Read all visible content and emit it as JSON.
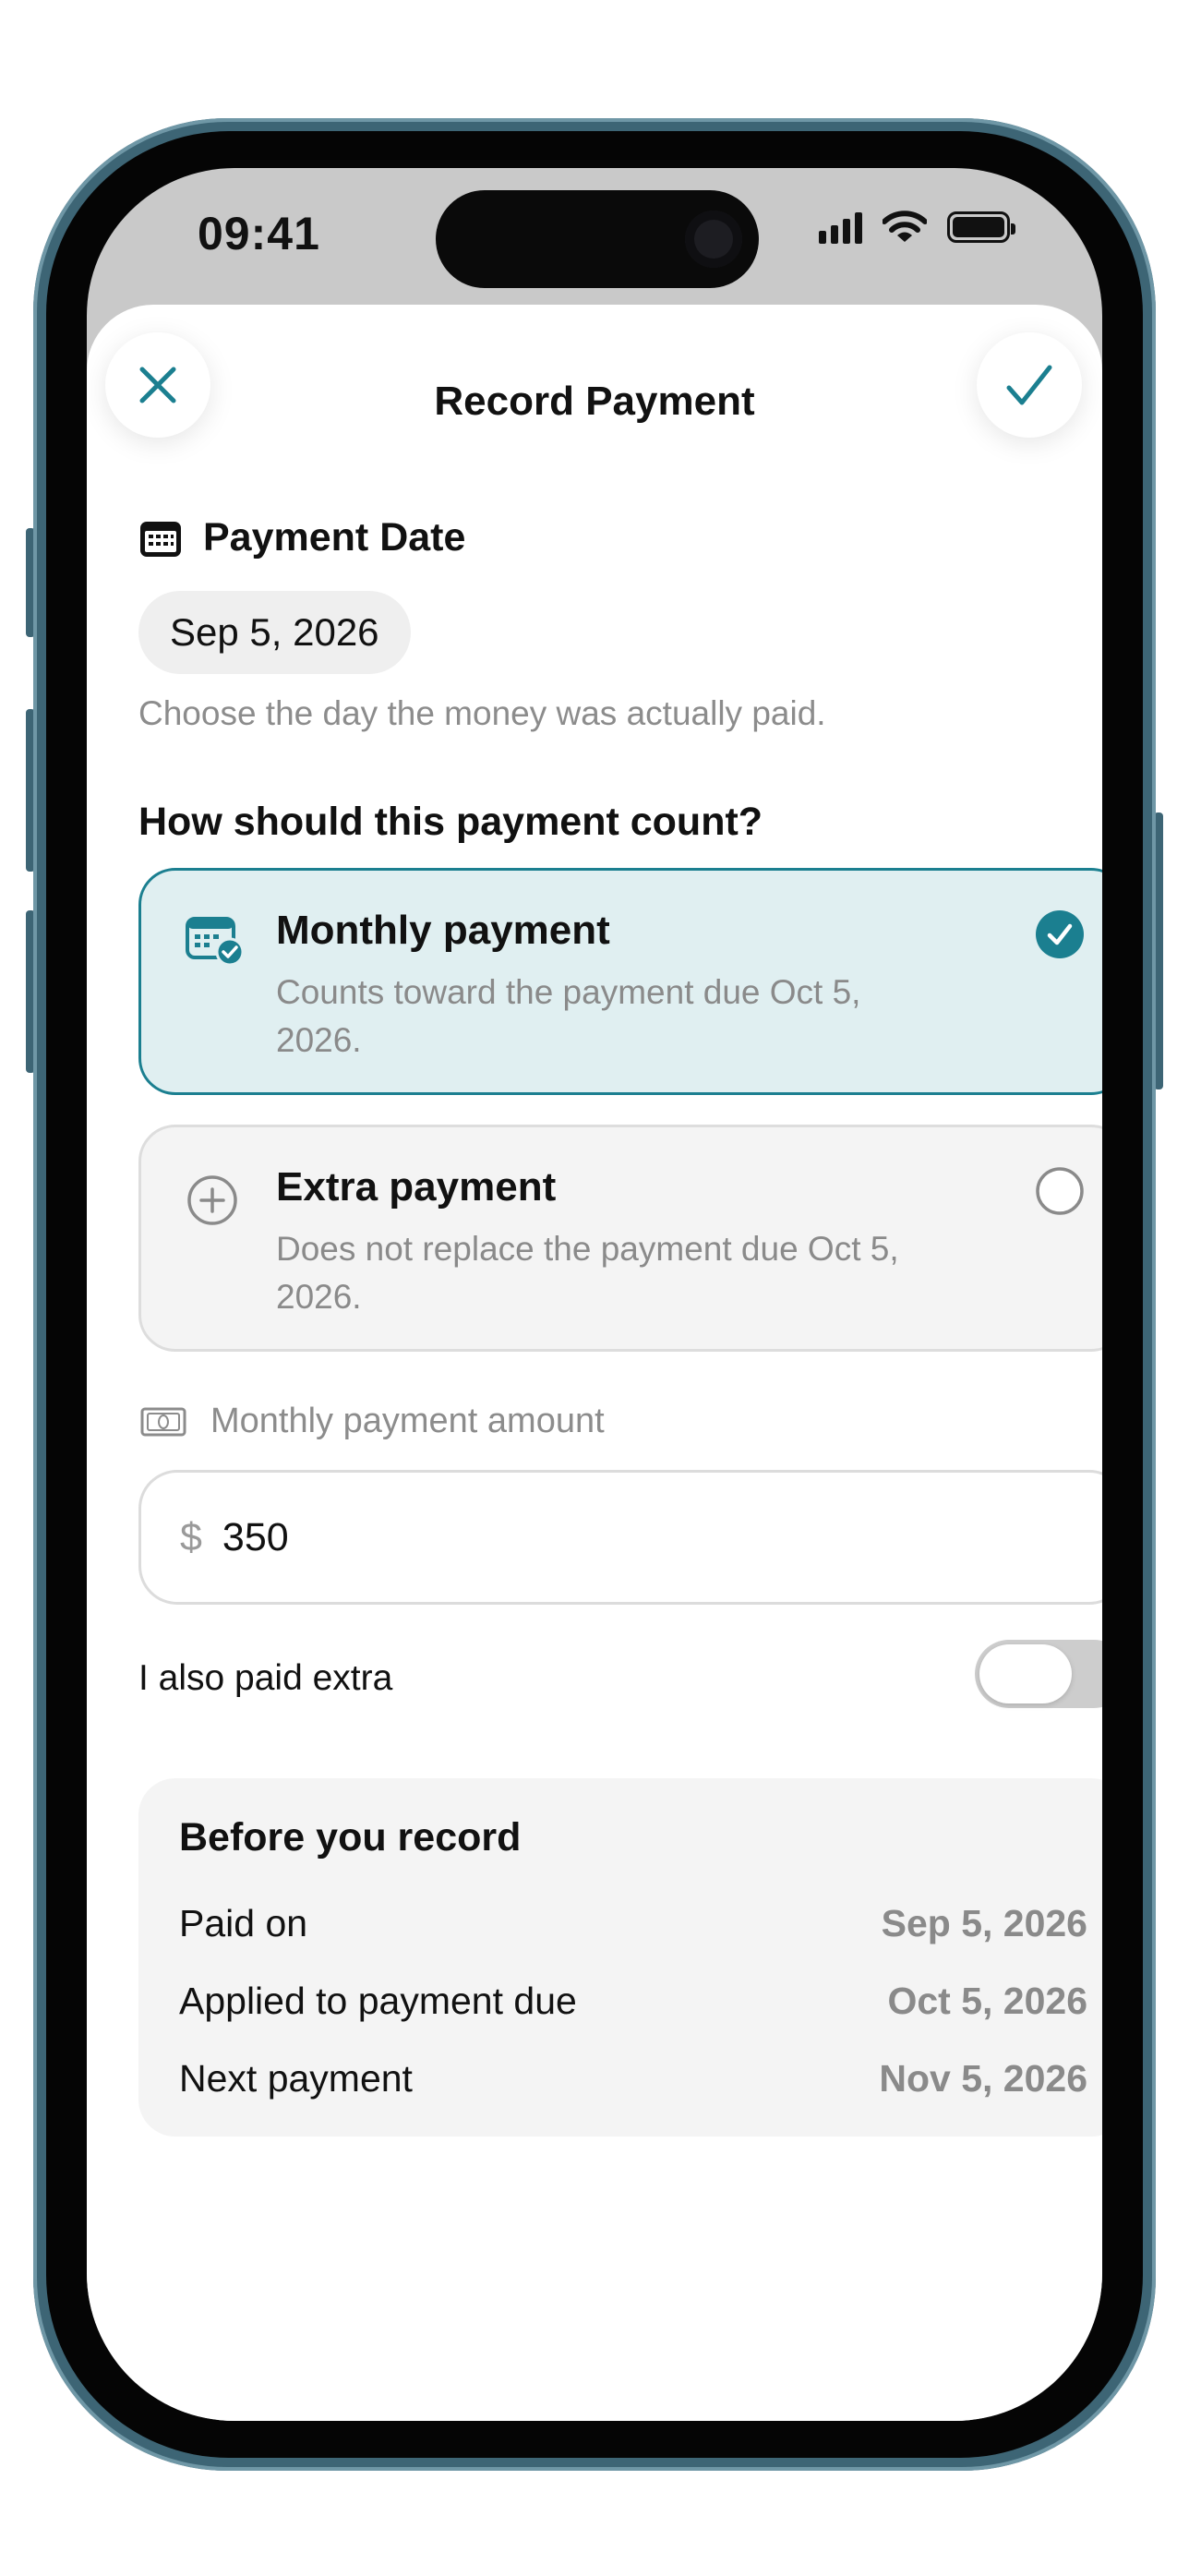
{
  "status_bar": {
    "time": "09:41"
  },
  "header": {
    "title": "Record Payment",
    "close_icon": "close-icon",
    "confirm_icon": "checkmark-icon"
  },
  "payment_date": {
    "heading": "Payment Date",
    "icon": "calendar-icon",
    "value": "Sep 5, 2026",
    "hint": "Choose the day the money was actually paid."
  },
  "count_question": "How should this payment count?",
  "options": [
    {
      "title": "Monthly payment",
      "description": "Counts toward the payment due Oct 5, 2026.",
      "selected": true,
      "icon": "calendar-check-icon"
    },
    {
      "title": "Extra payment",
      "description": "Does not replace the payment due Oct 5, 2026.",
      "selected": false,
      "icon": "plus-circle-icon"
    }
  ],
  "amount": {
    "label": "Monthly payment amount",
    "icon": "banknote-icon",
    "currency": "$",
    "value": "350"
  },
  "extra_toggle": {
    "label": "I also paid extra",
    "on": false
  },
  "summary": {
    "title": "Before you record",
    "rows": [
      {
        "label": "Paid on",
        "value": "Sep 5, 2026"
      },
      {
        "label": "Applied to payment due",
        "value": "Oct 5, 2026"
      },
      {
        "label": "Next payment",
        "value": "Nov 5, 2026"
      }
    ]
  },
  "colors": {
    "accent": "#1b7f90",
    "selected_bg": "#e0eff1",
    "frame": "#3d6575"
  }
}
